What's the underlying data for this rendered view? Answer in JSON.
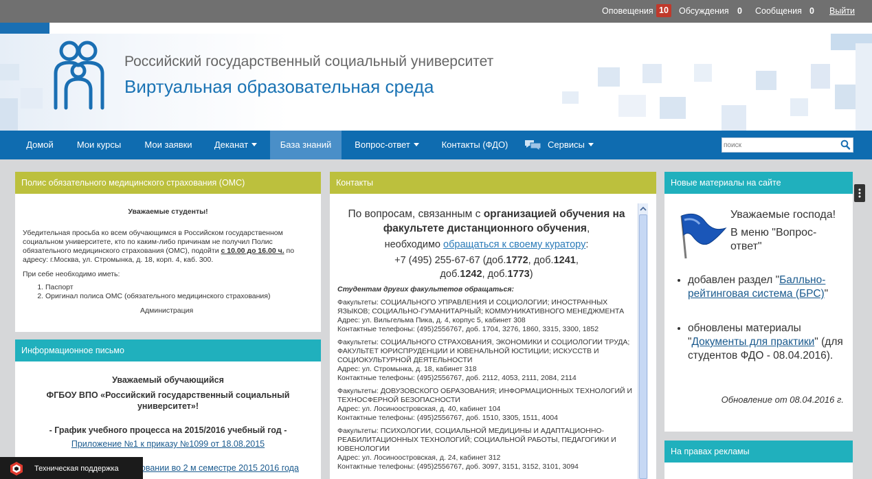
{
  "topbar": {
    "alerts_label": "Оповещения",
    "alerts_count": "10",
    "discussions_label": "Обсуждения",
    "discussions_count": "0",
    "messages_label": "Сообщения",
    "messages_count": "0",
    "logout_label": "Выйти"
  },
  "header": {
    "university_name": "Российский государственный социальный университет",
    "environment_name": "Виртуальная образовательная среда",
    "logo_icon": "family-logo-icon"
  },
  "nav": {
    "items": [
      {
        "label": "Домой"
      },
      {
        "label": "Мои курсы"
      },
      {
        "label": "Мои заявки"
      },
      {
        "label": "Деканат"
      },
      {
        "label": "База знаний"
      },
      {
        "label": "Вопрос-ответ"
      },
      {
        "label": "Контакты (ФДО)"
      },
      {
        "label": "Сервисы"
      }
    ],
    "active_label": "База знаний",
    "search_placeholder": "поиск",
    "services_icon": "chat-bubbles-icon",
    "search_icon": "search-icon"
  },
  "panels": {
    "oms": {
      "title": "Полис обязательного медицинского страхования (ОМС)",
      "greeting": "Уважаемые студенты!",
      "text_before": "Убедительная просьба ко всем обучающимся в Российском государственном социальном университете, кто по каким-либо причинам не получил Полис обязательного медицинского страхования (ОМС), подойти ",
      "time": "с 10.00 до 16.00 ч.",
      "text_after": " по адресу: г.Москва, ул. Стромынка, д. 18, корп. 4, каб. 300.",
      "need_label": "При себе необходимо иметь:",
      "items": [
        "Паспорт",
        "Оригинал полиса ОМС (обязательного медицинского страхования)"
      ],
      "signature": "Администрация"
    },
    "letter": {
      "title": "Информационное письмо",
      "greeting": "Уважаемый обучающийся",
      "org": "ФГБОУ ВПО «Российский государственный социальный университет»!",
      "schedule": "- График учебного процесса на 2015/2016 учебный год -",
      "link1": "Приложение №1 к приказу №1099 от 18.08.2015",
      "link2_partial": "нировании во 2 м семестре 2015 2016 года"
    },
    "contacts": {
      "title": "Контакты",
      "intro_1": "По вопросам, связанным с ",
      "intro_bold": "организацией обучения на факультете дистанционного обучения",
      "intro_2": ",",
      "need_text": "необходимо ",
      "curator_link": "обращаться к своему куратору",
      "need_colon": ":",
      "phone_prefix": "+7 (495) 255-67-67 (доб.",
      "ext1": "1772",
      "sep1": ", доб.",
      "ext2": "1241",
      "sep2": ", доб.",
      "ext3": "1242",
      "sep3": ", доб.",
      "ext4": "1773",
      "phone_suffix": ")",
      "other_students": "Студентам других факультетов обращаться:",
      "groups": [
        {
          "faculties": "Факультеты: СОЦИАЛЬНОГО УПРАВЛЕНИЯ И СОЦИОЛОГИИ; ИНОСТРАННЫХ ЯЗЫКОВ; СОЦИАЛЬНО-ГУМАНИТАРНЫЙ; КОММУНИКАТИВНОГО МЕНЕДЖМЕНТА",
          "address": "Адрес: ул. Вильгельма Пика, д. 4, корпус 5, кабинет 308",
          "phones": "Контактные телефоны: (495)2556767, доб. 1704, 3276, 1860, 3315, 3300, 1852"
        },
        {
          "faculties": "Факультеты: СОЦИАЛЬНОГО СТРАХОВАНИЯ, ЭКОНОМИКИ И СОЦИОЛОГИИ ТРУДА; ФАКУЛЬТЕТ ЮРИСПРУДЕНЦИИ И ЮВЕНАЛЬНОЙ ЮСТИЦИИ; ИСКУССТВ И СОЦИОКУЛЬТУРНОЙ ДЕЯТЕЛЬНОСТИ",
          "address": "Адрес: ул. Стромынка, д. 18, кабинет 318",
          "phones": "Контактные телефоны: (495)2556767, доб. 2112, 4053, 2111, 2084, 2114"
        },
        {
          "faculties": "Факультеты: ДОВУЗОВСКОГО ОБРАЗОВАНИЯ; ИНФОРМАЦИОННЫХ ТЕХНОЛОГИЙ И ТЕХНОСФЕРНОЙ БЕЗОПАСНОСТИ",
          "address": "Адрес: ул. Лосиноостровская, д. 40, кабинет 104",
          "phones": "Контактные телефоны: (495)2556767, доб. 1510, 3305, 1511, 4004"
        },
        {
          "faculties": "Факультеты: ПСИХОЛОГИИ, СОЦИАЛЬНОЙ МЕДИЦИНЫ И АДАПТАЦИОННО-РЕАБИЛИТАЦИОННЫХ ТЕХНОЛОГИЙ; СОЦИАЛЬНОЙ РАБОТЫ, ПЕДАГОГИКИ И ЮВЕНОЛОГИИ",
          "address": "Адрес: ул. Лосиноостровская, д. 24, кабинет 312",
          "phones": "Контактные телефоны: (495)2556767, доб. 3097, 3151, 3152, 3101, 3094"
        }
      ]
    },
    "news": {
      "title": "Новые материалы на сайте",
      "greeting": "Уважаемые господа!",
      "menu_text": "В меню \"Вопрос-ответ\"",
      "item1_text": "добавлен раздел ",
      "item1_link": "Балльно-рейтинговая система (БРС)",
      "item2_text": "обновлены материалы ",
      "item2_link": "Документы для практики",
      "item2_note": "(для студентов ФДО - 08.04.2016).",
      "update": "Обновление от 08.04.2016 г.",
      "flag_icon": "blue-flag-icon"
    },
    "ads": {
      "title": "На правах рекламы"
    }
  },
  "support": {
    "label": "Техническая поддержка",
    "icon": "support-hexagon-icon"
  },
  "colors": {
    "topbar": "#707070",
    "nav": "#0f6cb0",
    "nav_active": "#4a8fc8",
    "panel_olive": "#bcc03d",
    "panel_teal": "#20b0bd",
    "badge": "#c0392b",
    "page_bg": "#d6d7d9"
  }
}
